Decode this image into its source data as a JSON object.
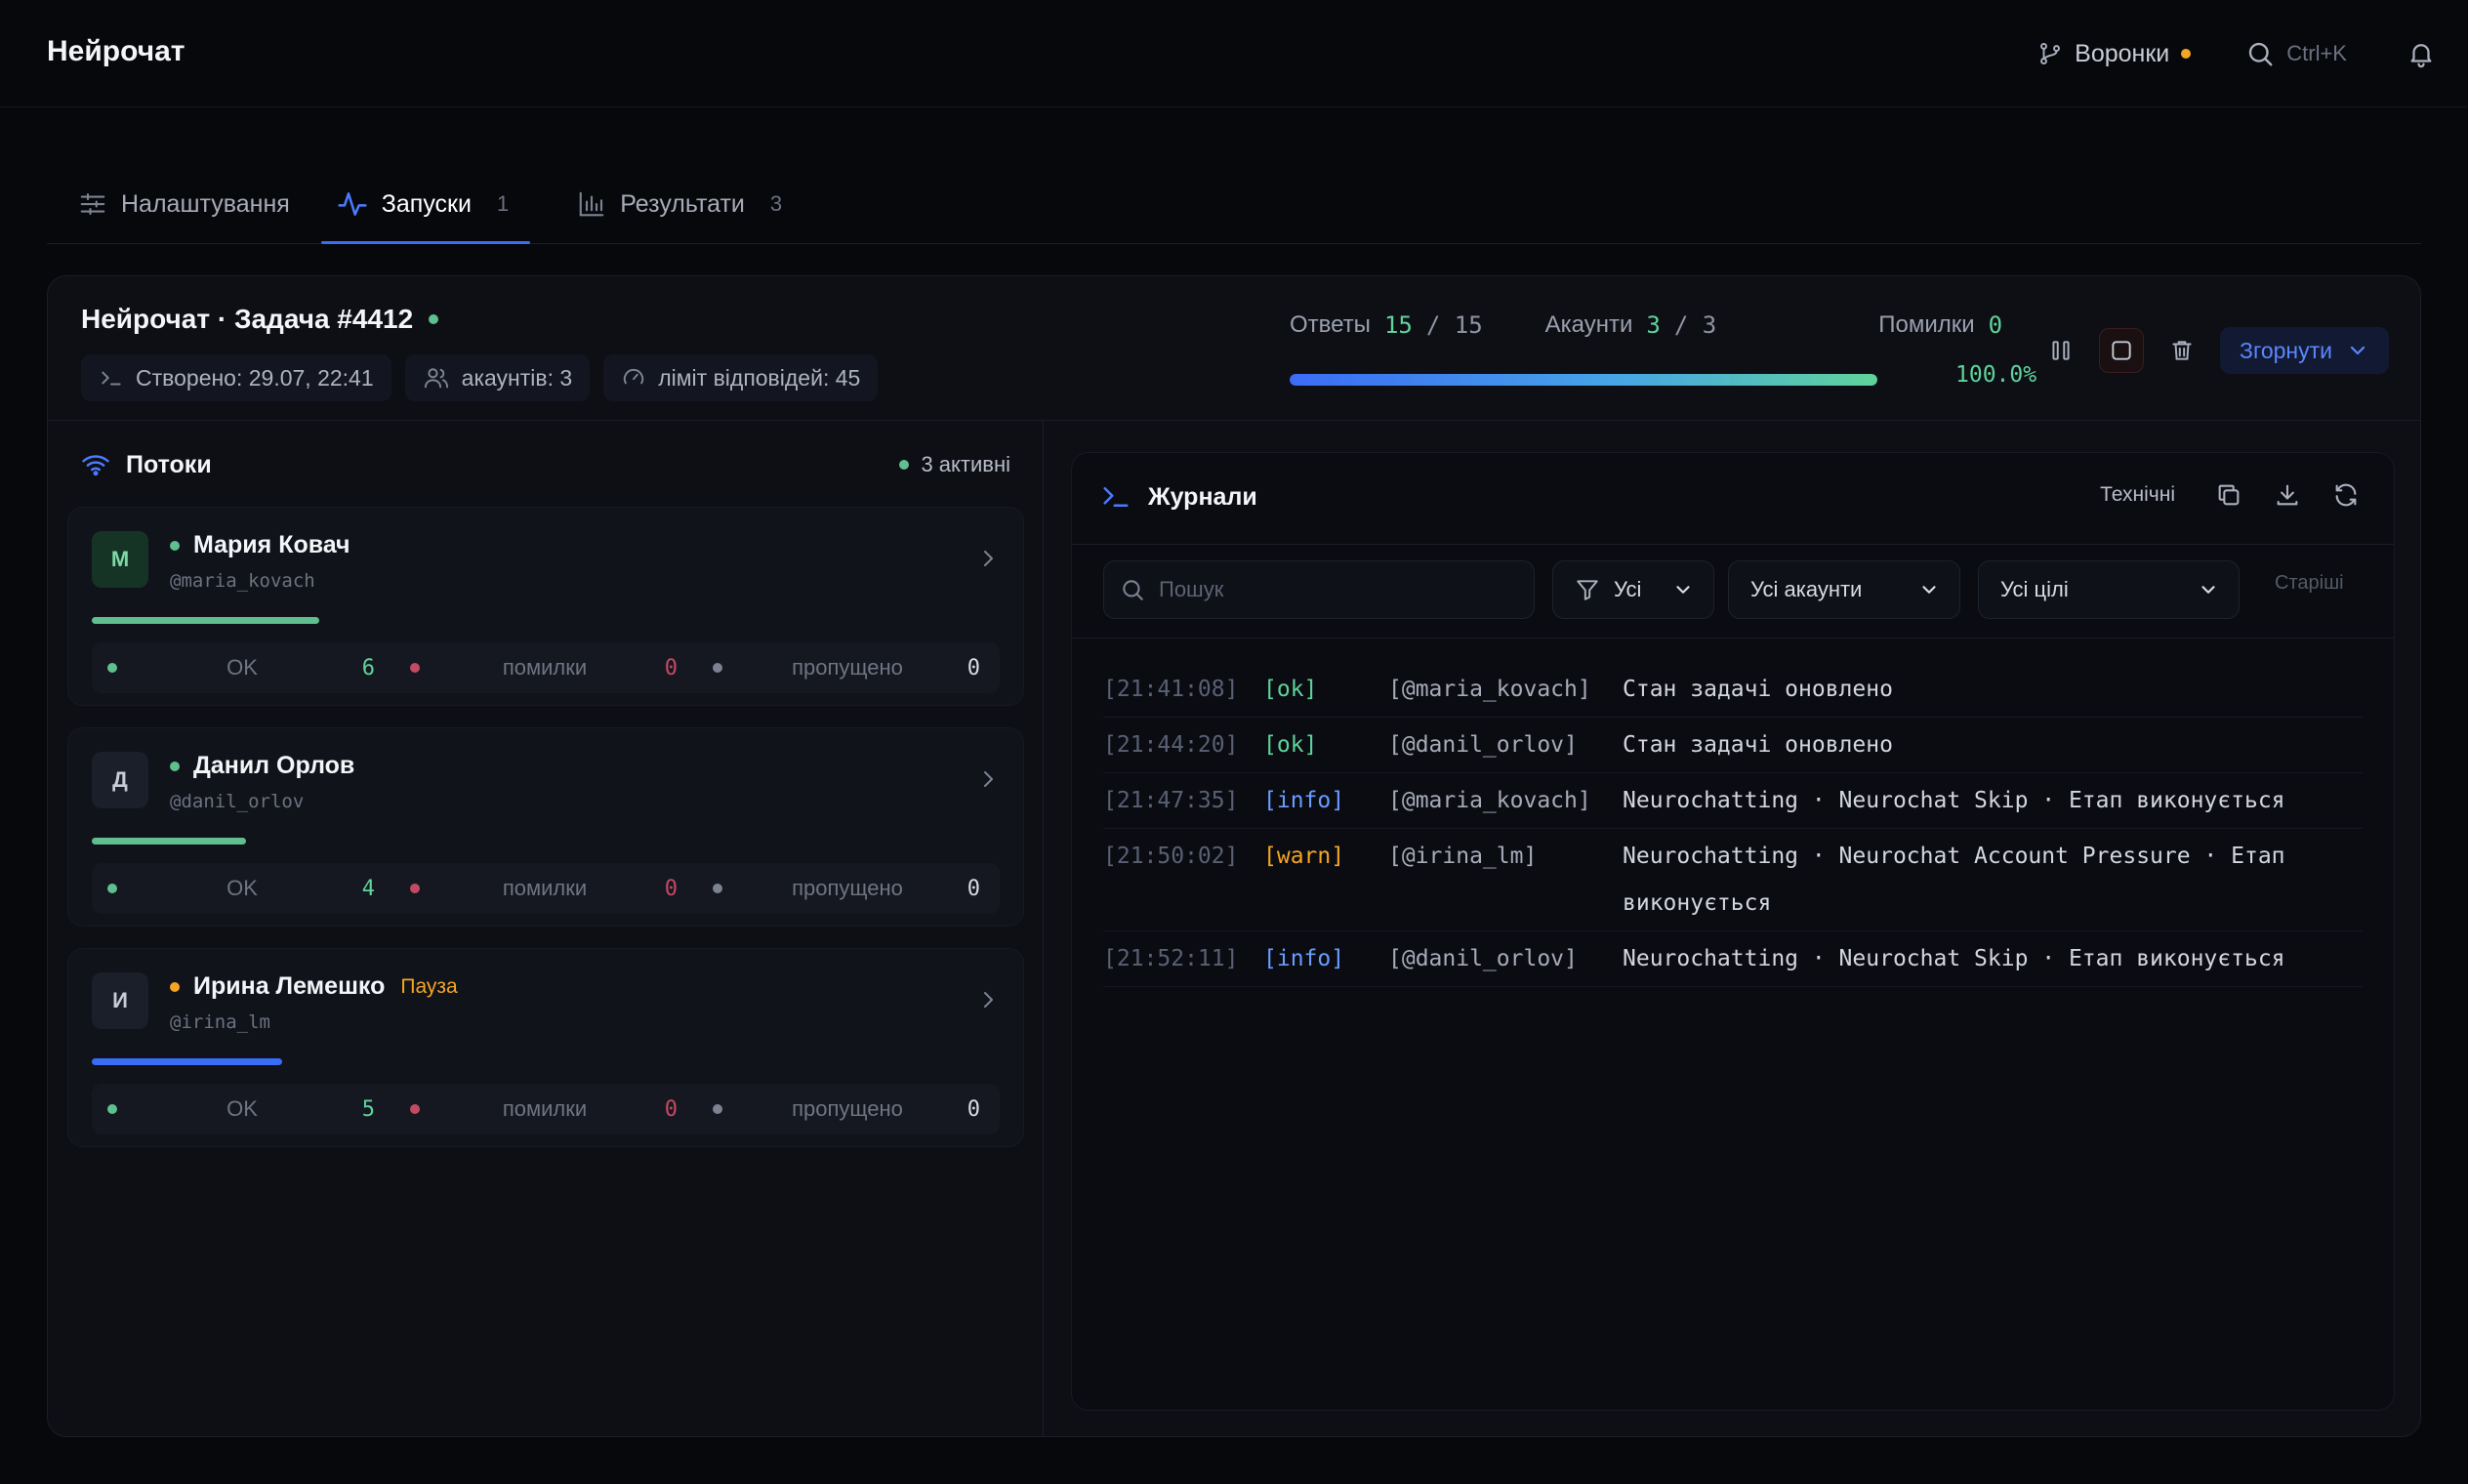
{
  "app": {
    "title": "Нейрочат"
  },
  "topbar": {
    "funnels_label": "Воронки",
    "search_shortcut": "Ctrl+K"
  },
  "tabs": [
    {
      "label": "Налаштування",
      "icon": "sliders-icon"
    },
    {
      "label": "Запуски",
      "count": "1",
      "icon": "activity-icon",
      "active": true
    },
    {
      "label": "Результати",
      "count": "3",
      "icon": "bar-chart-icon"
    }
  ],
  "task": {
    "title": "Нейрочат · Задача #4412",
    "created": "Створено: 29.07, 22:41",
    "accounts": "акаунтів: 3",
    "limit": "ліміт відповідей: 45"
  },
  "stats": {
    "answers_label": "Ответы",
    "answers_done": "15",
    "answers_total": "/ 15",
    "accounts_label": "Акаунти",
    "accounts_done": "3",
    "accounts_total": "/ 3",
    "errors_label": "Помилки",
    "errors_value": "0",
    "progress_percent": "100.0%",
    "progress_fraction": 1.0
  },
  "actions": {
    "collapse_label": "Згорнути"
  },
  "streams": {
    "title": "Потоки",
    "active_label": "3 активні",
    "items": [
      {
        "initial": "М",
        "name": "Мария Ковач",
        "handle": "@maria_kovach",
        "status_color": "#5fbf8e",
        "pause_label": "",
        "progress": 0.25,
        "bar_color": "#5fbf8e",
        "ok_label": "OK",
        "ok": "6",
        "errors_label": "помилки",
        "errors": "0",
        "skipped_label": "пропущено",
        "skipped": "0"
      },
      {
        "initial": "Д",
        "name": "Данил Орлов",
        "handle": "@danil_orlov",
        "status_color": "#5fbf8e",
        "pause_label": "",
        "progress": 0.17,
        "bar_color": "#5fbf8e",
        "ok_label": "OK",
        "ok": "4",
        "errors_label": "помилки",
        "errors": "0",
        "skipped_label": "пропущено",
        "skipped": "0"
      },
      {
        "initial": "И",
        "name": "Ирина Лемешко",
        "handle": "@irina_lm",
        "status_color": "#f5a524",
        "pause_label": "Пауза",
        "progress": 0.21,
        "bar_color": "#3b6cf6",
        "ok_label": "OK",
        "ok": "5",
        "errors_label": "помилки",
        "errors": "0",
        "skipped_label": "пропущено",
        "skipped": "0"
      }
    ]
  },
  "logs": {
    "title": "Журнали",
    "technical_label": "Технічні",
    "search_placeholder": "Пошук",
    "filter_level": "Усі",
    "filter_accounts": "Усі акаунти",
    "filter_targets": "Усі цілі",
    "older_label": "Старіші",
    "rows": [
      {
        "time": "[21:41:08]",
        "level": "[ok]",
        "kind": "ok",
        "account": "[@maria_kovach]",
        "message": "Стан задачі оновлено"
      },
      {
        "time": "[21:44:20]",
        "level": "[ok]",
        "kind": "ok",
        "account": "[@danil_orlov]",
        "message": "Стан задачі оновлено"
      },
      {
        "time": "[21:47:35]",
        "level": "[info]",
        "kind": "info",
        "account": "[@maria_kovach]",
        "message": "Neurochatting · Neurochat Skip · Етап виконується"
      },
      {
        "time": "[21:50:02]",
        "level": "[warn]",
        "kind": "warn",
        "account": "[@irina_lm]",
        "message": "Neurochatting · Neurochat Account Pressure · Етап виконується"
      },
      {
        "time": "[21:52:11]",
        "level": "[info]",
        "kind": "info",
        "account": "[@danil_orlov]",
        "message": "Neurochatting · Neurochat Skip · Етап виконується"
      }
    ]
  }
}
